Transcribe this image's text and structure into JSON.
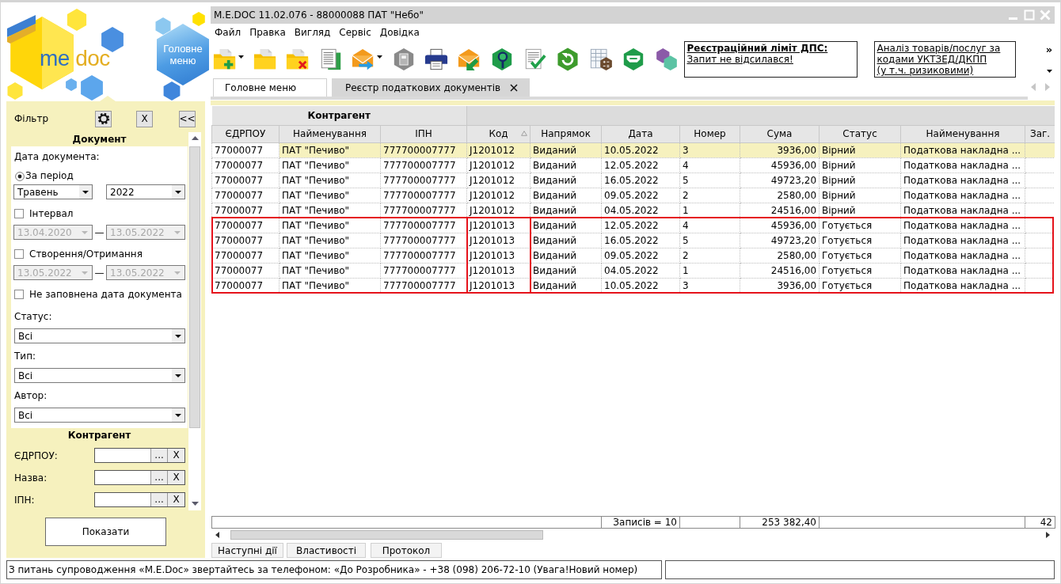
{
  "logo": {
    "text_1": "me",
    "text_2": "doc"
  },
  "main_menu_button": {
    "label": "Головне меню"
  },
  "filter": {
    "title": "Фільтр",
    "buttons": [
      {
        "kind": "gear"
      },
      {
        "kind": "text",
        "label": "X"
      },
      {
        "kind": "text",
        "label": "<<"
      }
    ],
    "document": {
      "title": "Документ",
      "date_label": "Дата документа:",
      "period": {
        "label": "За період",
        "selected": true,
        "month": "Травень",
        "year": "2022"
      },
      "ranges": [
        {
          "label": "Інтервал",
          "checked": false,
          "disabled": true,
          "from": "13.04.2020",
          "separator": "—",
          "to": "13.05.2022"
        },
        {
          "label": "Створення/Отримання",
          "checked": false,
          "disabled": true,
          "from": "13.05.2022",
          "separator": "—",
          "to": "13.05.2022"
        }
      ],
      "empty_date": {
        "label": "Не заповнена дата документа",
        "checked": false
      },
      "selects": [
        {
          "label": "Статус:",
          "value": "Всі"
        },
        {
          "label": "Тип:",
          "value": "Всі"
        },
        {
          "label": "Автор:",
          "value": "Всі"
        }
      ]
    },
    "counterparty": {
      "title": "Контрагент",
      "fields": [
        {
          "label": "ЄДРПОУ:",
          "browse": "...",
          "clear": "X"
        },
        {
          "label": "Назва:",
          "browse": "...",
          "clear": "X"
        },
        {
          "label": "ІПН:",
          "browse": "...",
          "clear": "X"
        }
      ]
    },
    "show_button": "Показати"
  },
  "window": {
    "title": "M.E.DOC 11.02.076 - 88000088 ПАТ \"Небо\""
  },
  "menu": [
    "Файл",
    "Правка",
    "Вигляд",
    "Сервіс",
    "Довідка"
  ],
  "toolbar": [
    {
      "kind": "folder-plus",
      "dropdown": true
    },
    {
      "kind": "folder",
      "dropdown": false
    },
    {
      "kind": "folder-cross",
      "dropdown": false
    },
    {
      "kind": "documents",
      "dropdown": false
    },
    {
      "kind": "envelope-out",
      "dropdown": true
    },
    {
      "kind": "scanner",
      "dropdown": false
    },
    {
      "kind": "printer",
      "dropdown": false
    },
    {
      "kind": "envelope-in",
      "dropdown": false
    },
    {
      "kind": "hex-search",
      "dropdown": false
    },
    {
      "kind": "document-check",
      "dropdown": false
    },
    {
      "kind": "refresh",
      "dropdown": false
    },
    {
      "kind": "table-calc",
      "dropdown": false
    },
    {
      "kind": "hex-tray",
      "dropdown": false
    },
    {
      "kind": "hexagons",
      "dropdown": false
    }
  ],
  "notices": [
    {
      "title": "Реєстраційний ліміт ДПС:",
      "text": "Запит не відсилався!"
    },
    {
      "lines": [
        "Аналіз товарів/послуг за",
        "кодами УКТЗЕД/ДКПП",
        "(у т.ч. ризиковими)"
      ]
    }
  ],
  "toolbar_overflow": "»",
  "tabs": [
    {
      "label": "Головне меню",
      "selected": false,
      "closable": false
    },
    {
      "label": "Реєстр податкових документів",
      "selected": true,
      "closable": true
    }
  ],
  "table": {
    "sections": [
      {
        "label": "Контрагент",
        "columns": [
          {
            "label": "ЄДРПОУ",
            "kind": "text",
            "sorted": false
          },
          {
            "label": "Найменування",
            "kind": "text",
            "sorted": false
          },
          {
            "label": "ІПН",
            "kind": "text",
            "sorted": false
          }
        ]
      },
      {
        "columns": [
          {
            "label": "Код",
            "kind": "text",
            "sorted": true
          }
        ]
      },
      {
        "columns": [
          {
            "label": "Напрямок",
            "kind": "text",
            "sorted": false
          },
          {
            "label": "Дата",
            "kind": "text",
            "sorted": false,
            "total": "Записів = 10"
          },
          {
            "label": "Номер",
            "kind": "text",
            "sorted": false
          },
          {
            "label": "Сума",
            "kind": "amount",
            "sorted": false,
            "total": "253 382,40"
          },
          {
            "label": "Статус",
            "kind": "text",
            "sorted": false
          },
          {
            "label": "Найменування",
            "kind": "text",
            "sorted": false
          },
          {
            "label": "Заг.",
            "kind": "text",
            "sorted": false,
            "total": "42"
          }
        ]
      }
    ],
    "rows": [
      {
        "cells": [
          "77000077",
          "ПАТ \"Печиво\"",
          "777700007777",
          "J1201012",
          "Виданий",
          "10.05.2022",
          "3",
          "3936,00",
          "Вірний",
          "Податкова накладна ..."
        ],
        "selected": true,
        "outlined": false
      },
      {
        "cells": [
          "77000077",
          "ПАТ \"Печиво\"",
          "777700007777",
          "J1201012",
          "Виданий",
          "12.05.2022",
          "4",
          "45936,00",
          "Вірний",
          "Податкова накладна ..."
        ],
        "selected": false,
        "outlined": false
      },
      {
        "cells": [
          "77000077",
          "ПАТ \"Печиво\"",
          "777700007777",
          "J1201012",
          "Виданий",
          "16.05.2022",
          "5",
          "49723,20",
          "Вірний",
          "Податкова накладна ..."
        ],
        "selected": false,
        "outlined": false
      },
      {
        "cells": [
          "77000077",
          "ПАТ \"Печиво\"",
          "777700007777",
          "J1201012",
          "Виданий",
          "09.05.2022",
          "2",
          "2580,00",
          "Вірний",
          "Податкова накладна ..."
        ],
        "selected": false,
        "outlined": false
      },
      {
        "cells": [
          "77000077",
          "ПАТ \"Печиво\"",
          "777700007777",
          "J1201012",
          "Виданий",
          "04.05.2022",
          "1",
          "24516,00",
          "Вірний",
          "Податкова накладна ..."
        ],
        "selected": false,
        "outlined": false
      },
      {
        "cells": [
          "77000077",
          "ПАТ \"Печиво\"",
          "777700007777",
          "J1201013",
          "Виданий",
          "12.05.2022",
          "4",
          "45936,00",
          "Готується",
          "Податкова накладна ..."
        ],
        "selected": false,
        "outlined": true
      },
      {
        "cells": [
          "77000077",
          "ПАТ \"Печиво\"",
          "777700007777",
          "J1201013",
          "Виданий",
          "16.05.2022",
          "5",
          "49723,20",
          "Готується",
          "Податкова накладна ..."
        ],
        "selected": false,
        "outlined": true
      },
      {
        "cells": [
          "77000077",
          "ПАТ \"Печиво\"",
          "777700007777",
          "J1201013",
          "Виданий",
          "09.05.2022",
          "2",
          "2580,00",
          "Готується",
          "Податкова накладна ..."
        ],
        "selected": false,
        "outlined": true
      },
      {
        "cells": [
          "77000077",
          "ПАТ \"Печиво\"",
          "777700007777",
          "J1201013",
          "Виданий",
          "04.05.2022",
          "1",
          "24516,00",
          "Готується",
          "Податкова накладна ..."
        ],
        "selected": false,
        "outlined": true
      },
      {
        "cells": [
          "77000077",
          "ПАТ \"Печиво\"",
          "777700007777",
          "J1201013",
          "Виданий",
          "10.05.2022",
          "3",
          "3936,00",
          "Готується",
          "Податкова накладна ..."
        ],
        "selected": false,
        "outlined": true
      }
    ]
  },
  "bottom_tabs": [
    "Наступні дії",
    "Властивості",
    "Протокол"
  ],
  "status_bar": {
    "message": "З питань супроводження «M.E.Doc» звертайтесь за телефоном: «До Розробника» - +38 (098) 206-72-10 (Увага!Новий номер)"
  }
}
